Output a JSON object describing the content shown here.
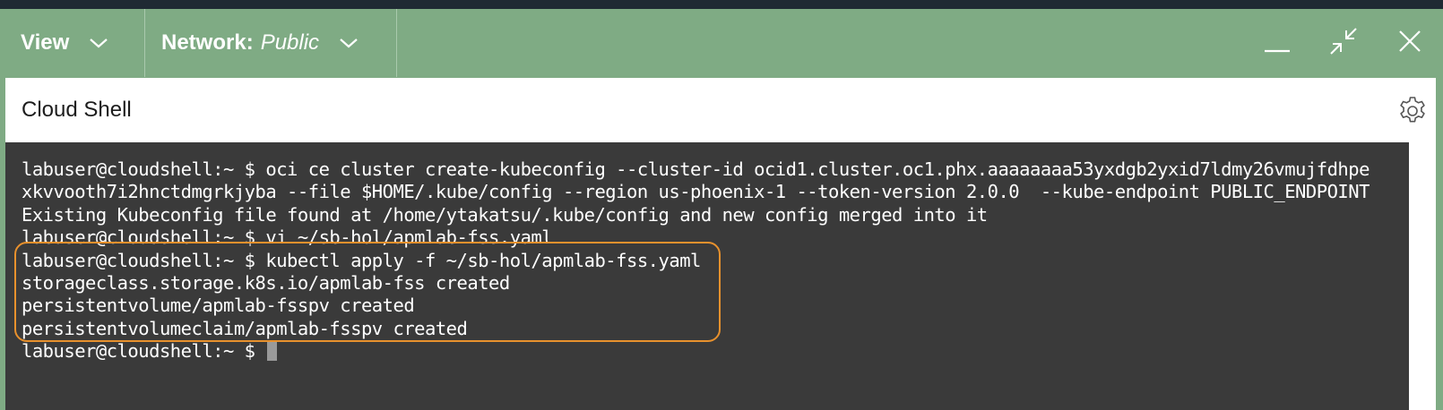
{
  "toolbar": {
    "view_label": "View",
    "network_label": "Network:",
    "network_value": "Public"
  },
  "panel": {
    "title": "Cloud Shell"
  },
  "terminal": {
    "lines": [
      "labuser@cloudshell:~ $ oci ce cluster create-kubeconfig --cluster-id ocid1.cluster.oc1.phx.aaaaaaaa53yxdgb2yxid7ldmy26vmujfdhpe",
      "xkvvooth7i2hnctdmgrkjyba --file $HOME/.kube/config --region us-phoenix-1 --token-version 2.0.0  --kube-endpoint PUBLIC_ENDPOINT",
      "Existing Kubeconfig file found at /home/ytakatsu/.kube/config and new config merged into it",
      "labuser@cloudshell:~ $ vi ~/sb-hol/apmlab-fss.yaml",
      "labuser@cloudshell:~ $ kubectl apply -f ~/sb-hol/apmlab-fss.yaml",
      "storageclass.storage.k8s.io/apmlab-fss created",
      "persistentvolume/apmlab-fsspv created",
      "persistentvolumeclaim/apmlab-fsspv created",
      "labuser@cloudshell:~ $ "
    ]
  },
  "icons": {
    "view_chevron": "chevron-down-icon",
    "network_chevron": "chevron-down-icon",
    "minimize": "minimize-icon",
    "restore": "restore-icon",
    "close": "close-icon",
    "settings": "gear-icon"
  },
  "colors": {
    "toolbar_bg": "#7fab84",
    "terminal_bg": "#3a3a3a",
    "highlight": "#e8912d"
  }
}
